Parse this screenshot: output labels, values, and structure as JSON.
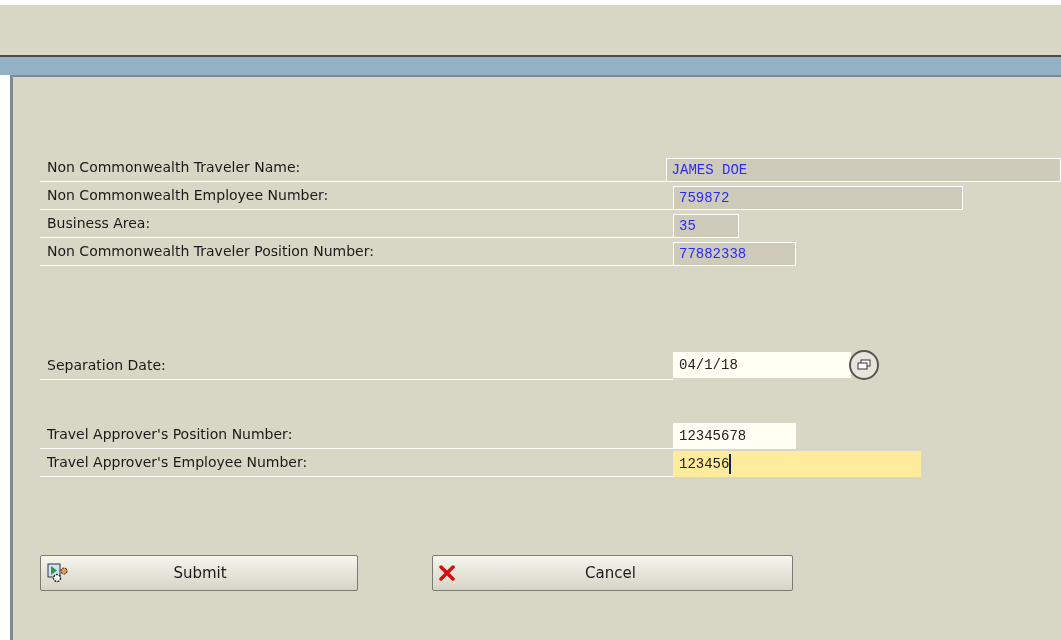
{
  "groups": [
    {
      "fields": [
        {
          "label": "Non Commonwealth Traveler Name:",
          "value": "JAMES DOE",
          "kind": "display",
          "focused": false
        },
        {
          "label": "Non Commonwealth Employee Number:",
          "value": "759872",
          "kind": "display",
          "focused": false
        },
        {
          "label": "Business Area:",
          "value": "35",
          "kind": "display",
          "focused": false
        },
        {
          "label": "Non Commonwealth Traveler Position Number:",
          "value": "77882338",
          "kind": "display",
          "focused": false
        }
      ]
    },
    {
      "fields": [
        {
          "label": "Separation Date:",
          "value": "04/1/18",
          "kind": "date",
          "focused": false
        }
      ]
    },
    {
      "fields": [
        {
          "label": "Travel Approver's Position Number:",
          "value": "12345678",
          "kind": "input",
          "focused": false
        },
        {
          "label": "Travel Approver's Employee Number:",
          "value": "123456",
          "kind": "input",
          "focused": true
        }
      ]
    }
  ],
  "buttons": [
    {
      "label": "Submit",
      "kind": "execute"
    },
    {
      "label": "Cancel",
      "kind": "cancel"
    }
  ]
}
